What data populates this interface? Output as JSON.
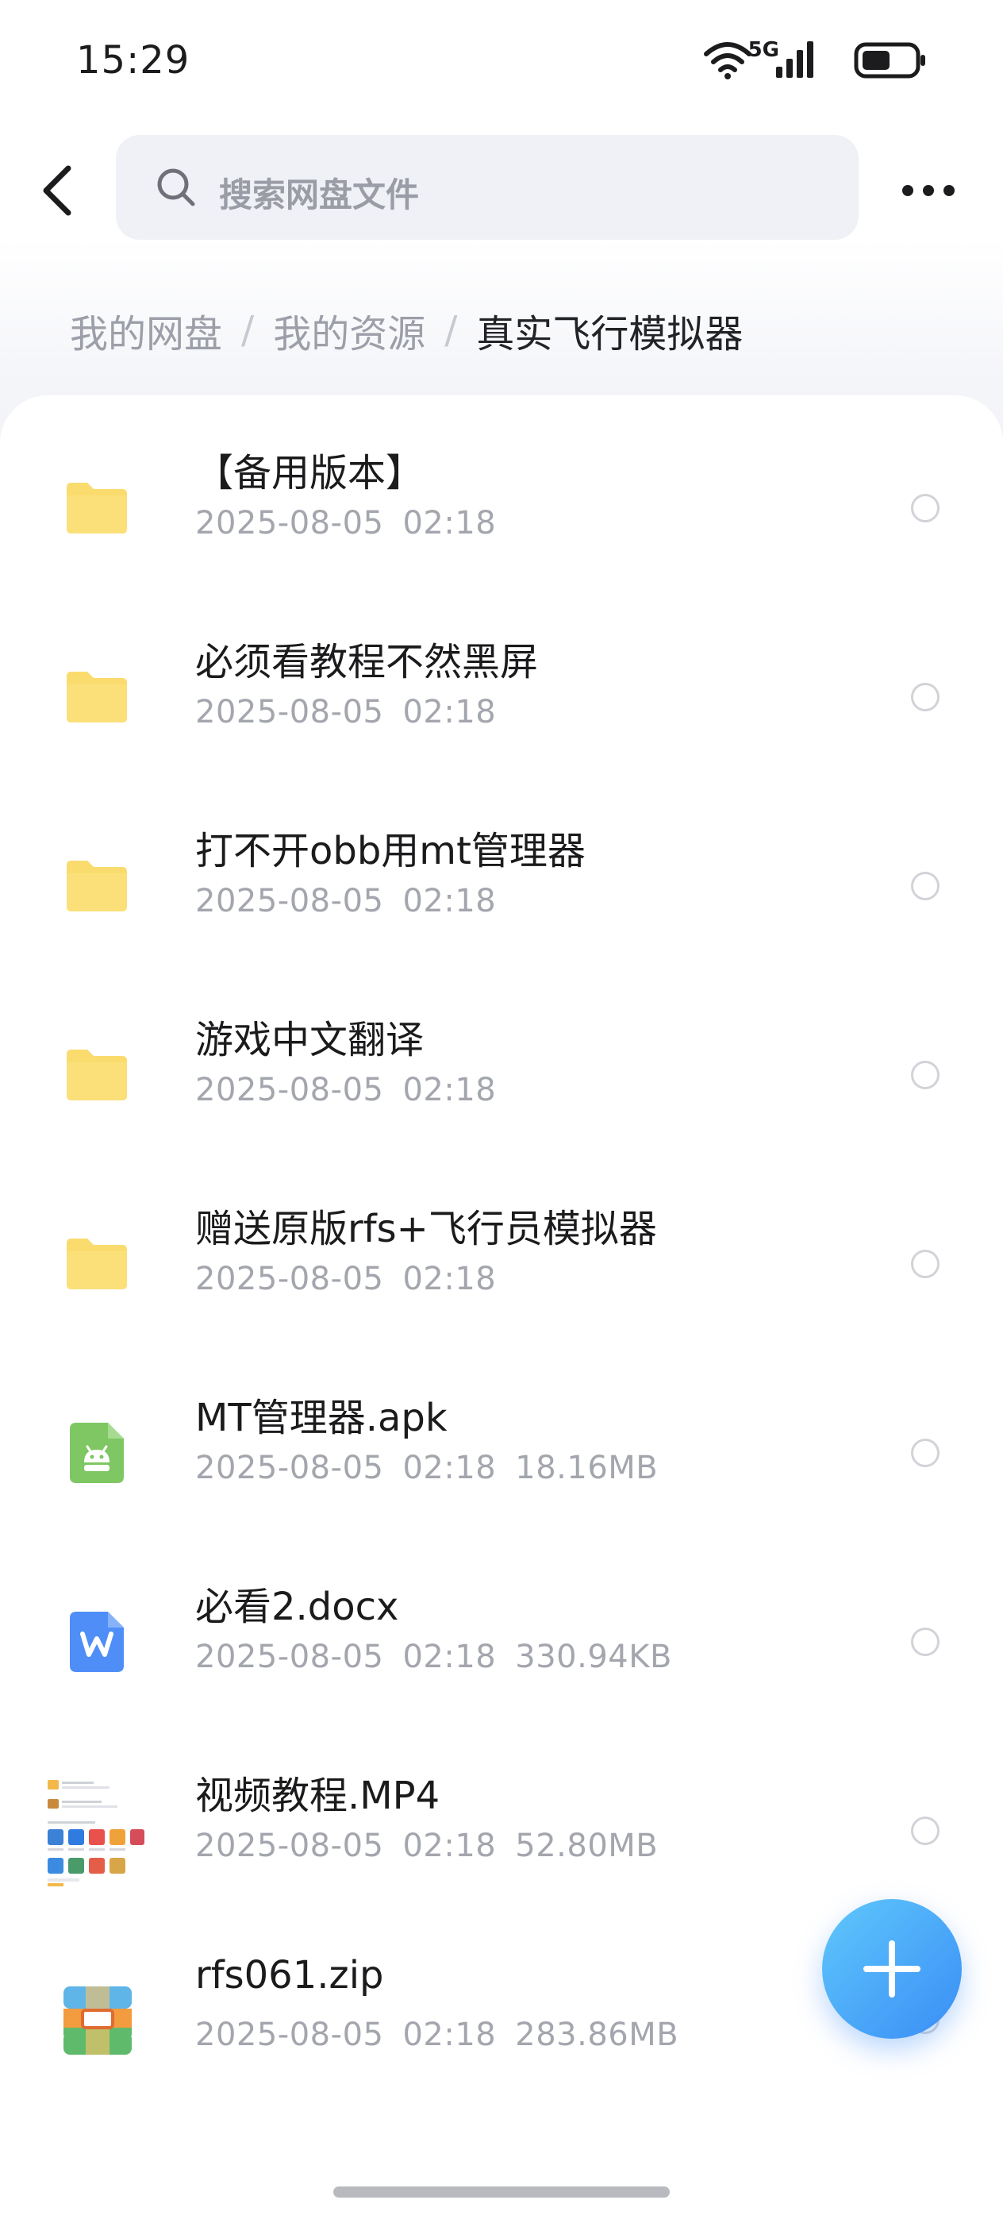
{
  "status_bar": {
    "time": "15:29",
    "network_label": "5G",
    "icons": [
      "wifi-icon",
      "signal-icon",
      "battery-icon"
    ],
    "battery_level": 0.55
  },
  "header": {
    "search_placeholder": "搜索网盘文件",
    "icons": [
      "back-arrow-icon",
      "search-icon",
      "more-dots-icon"
    ]
  },
  "breadcrumb": {
    "items": [
      "我的网盘",
      "我的资源"
    ],
    "current": "真实飞行模拟器",
    "separator": "/"
  },
  "files": [
    {
      "name": "【备用版本】",
      "date": "2025-08-05",
      "time": "02:18",
      "size": "",
      "type": "folder"
    },
    {
      "name": "必须看教程不然黑屏",
      "date": "2025-08-05",
      "time": "02:18",
      "size": "",
      "type": "folder"
    },
    {
      "name": "打不开obb用mt管理器",
      "date": "2025-08-05",
      "time": "02:18",
      "size": "",
      "type": "folder"
    },
    {
      "name": "游戏中文翻译",
      "date": "2025-08-05",
      "time": "02:18",
      "size": "",
      "type": "folder"
    },
    {
      "name": "赠送原版rfs+飞行员模拟器",
      "date": "2025-08-05",
      "time": "02:18",
      "size": "",
      "type": "folder"
    },
    {
      "name": "MT管理器.apk",
      "date": "2025-08-05",
      "time": "02:18",
      "size": "18.16MB",
      "type": "apk"
    },
    {
      "name": "必看2.docx",
      "date": "2025-08-05",
      "time": "02:18",
      "size": "330.94KB",
      "type": "docx"
    },
    {
      "name": "视频教程.MP4",
      "date": "2025-08-05",
      "time": "02:18",
      "size": "52.80MB",
      "type": "video"
    },
    {
      "name": "rfs061.zip",
      "date": "2025-08-05",
      "time": "02:18",
      "size": "283.86MB",
      "type": "zip"
    }
  ],
  "fab": {
    "icon": "plus-icon"
  },
  "colors": {
    "folder": "#fadb6e",
    "apk": "#7ec762",
    "docx": "#4f8ef7",
    "accent": "#3a8df6",
    "text_primary": "#1b1b1d",
    "text_secondary": "#a4a6ae"
  }
}
